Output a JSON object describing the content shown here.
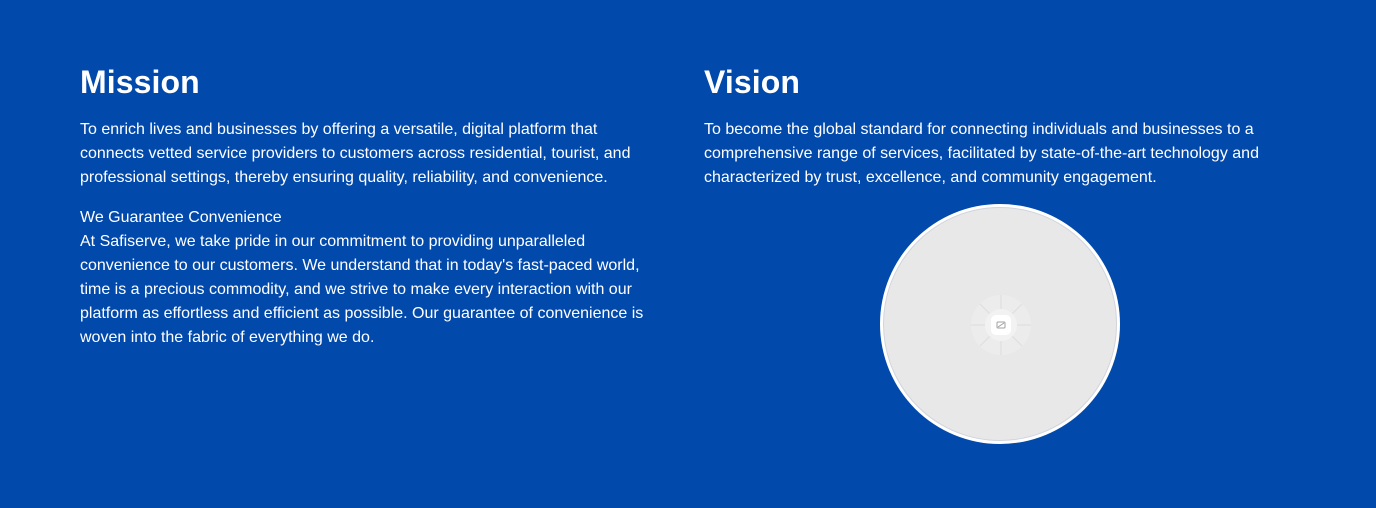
{
  "mission": {
    "title": "Mission",
    "text": "To enrich lives and businesses by offering a versatile, digital platform that connects vetted service providers to customers across residential, tourist, and professional settings, thereby ensuring quality, reliability, and convenience.",
    "guarantee_heading": "We Guarantee Convenience",
    "guarantee_text": "At Safiserve, we take pride in our commitment to providing unparalleled convenience to our customers. We understand that in today's fast-paced world, time is a precious commodity, and we strive to make every interaction with our platform as effortless and efficient as possible. Our guarantee of convenience is woven into the fabric of everything we do."
  },
  "vision": {
    "title": "Vision",
    "text": "To become the global standard for connecting individuals and businesses to a comprehensive range of services, facilitated by state-of-the-art technology and characterized by trust, excellence, and community engagement."
  },
  "image": {
    "icon": "image-placeholder-icon"
  },
  "colors": {
    "background": "#0249AC",
    "text": "#FFFFFF",
    "placeholder": "#E8E8E8"
  }
}
